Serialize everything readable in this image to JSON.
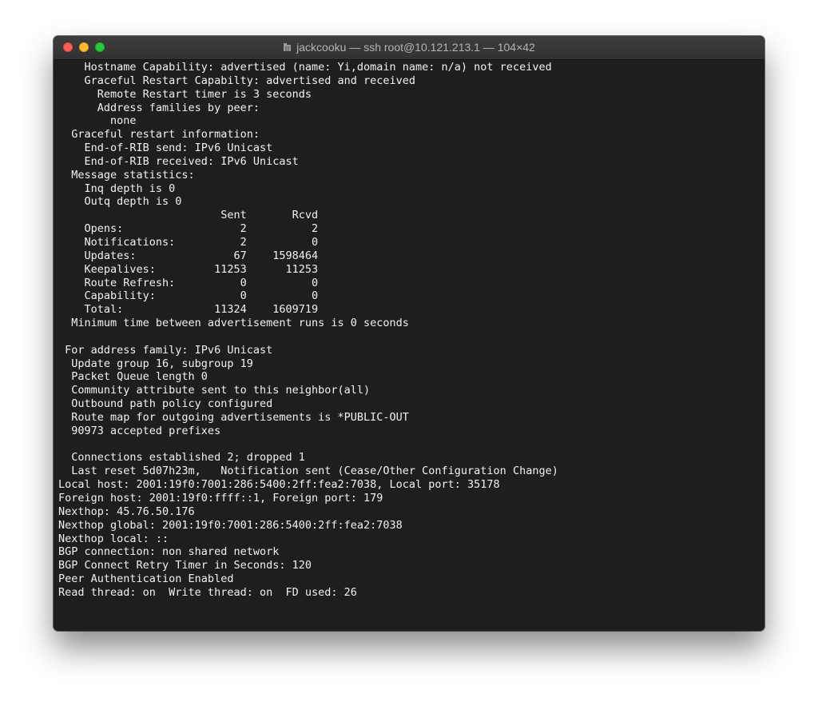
{
  "window": {
    "title": "jackcooku — ssh root@10.121.213.1 — 104×42",
    "title_icon": "folder-icon",
    "controls": {
      "close": "#ff5f57",
      "minimize": "#febc2e",
      "zoom": "#28c840"
    }
  },
  "terminal": {
    "background": "#1e1e1e",
    "foreground": "#f2f2f2",
    "lines": [
      "    Hostname Capability: advertised (name: Yi,domain name: n/a) not received",
      "    Graceful Restart Capabilty: advertised and received",
      "      Remote Restart timer is 3 seconds",
      "      Address families by peer:",
      "        none",
      "  Graceful restart information:",
      "    End-of-RIB send: IPv6 Unicast",
      "    End-of-RIB received: IPv6 Unicast",
      "  Message statistics:",
      "    Inq depth is 0",
      "    Outq depth is 0",
      "                         Sent       Rcvd",
      "    Opens:                  2          2",
      "    Notifications:          2          0",
      "    Updates:               67    1598464",
      "    Keepalives:         11253      11253",
      "    Route Refresh:          0          0",
      "    Capability:             0          0",
      "    Total:              11324    1609719",
      "  Minimum time between advertisement runs is 0 seconds",
      "",
      " For address family: IPv6 Unicast",
      "  Update group 16, subgroup 19",
      "  Packet Queue length 0",
      "  Community attribute sent to this neighbor(all)",
      "  Outbound path policy configured",
      "  Route map for outgoing advertisements is *PUBLIC-OUT",
      "  90973 accepted prefixes",
      "",
      "  Connections established 2; dropped 1",
      "  Last reset 5d07h23m,   Notification sent (Cease/Other Configuration Change)",
      "Local host: 2001:19f0:7001:286:5400:2ff:fea2:7038, Local port: 35178",
      "Foreign host: 2001:19f0:ffff::1, Foreign port: 179",
      "Nexthop: 45.76.50.176",
      "Nexthop global: 2001:19f0:7001:286:5400:2ff:fea2:7038",
      "Nexthop local: ::",
      "BGP connection: non shared network",
      "BGP Connect Retry Timer in Seconds: 120",
      "Peer Authentication Enabled",
      "Read thread: on  Write thread: on  FD used: 26"
    ]
  }
}
